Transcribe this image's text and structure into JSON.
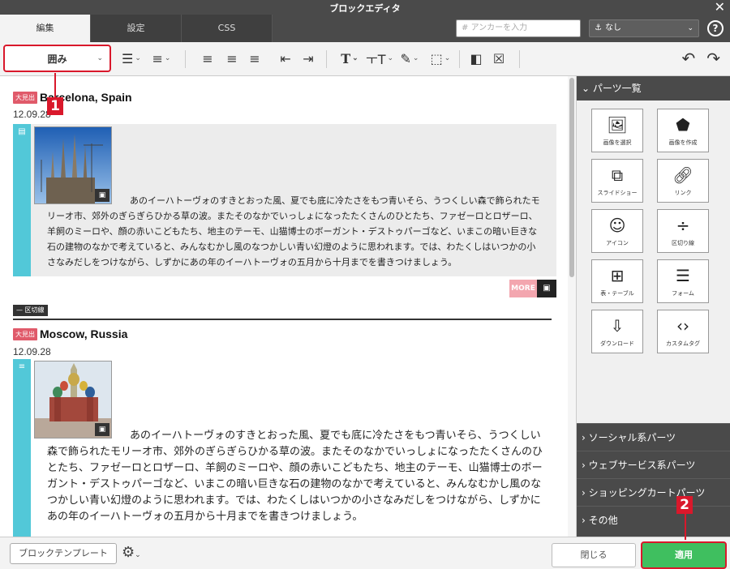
{
  "window": {
    "title": "ブロックエディタ",
    "close": "✕"
  },
  "tabs": [
    "編集",
    "設定",
    "CSS"
  ],
  "anchor": {
    "placeholder": "アンカーを入力",
    "icon": "#"
  },
  "anchor_select": {
    "value": "なし",
    "icon": "anchor-icon"
  },
  "help": "?",
  "toolbar": {
    "block_type": "囲み",
    "caret": "⌄",
    "undo": "↶",
    "redo": "↷"
  },
  "callouts": {
    "one": "1",
    "two": "2"
  },
  "articles": [
    {
      "badge": "大見出",
      "title": "Barcelona, Spain",
      "date": "12.09.28",
      "paragraph": "あのイーハトーヴォのすきとおった風、夏でも底に冷たさをもつ青いそら、うつくしい森で飾られたモリーオ市、郊外のぎらぎらひかる草の波。またそのなかでいっしょになったたくさんのひとたち、ファゼーロとロザーロ、羊飼のミーロや、顔の赤いこどもたち、地主のテーモ、山猫博士のボーガント・デストゥパーゴなど、いまこの暗い巨きな石の建物のなかで考えていると、みんなむかし風のなつかしい青い幻燈のように思われます。では、わたくしはいつかの小さなみだしをつけながら、しずかにあの年のイーハトーヴォの五月から十月までを書きつけましょう。"
    },
    {
      "badge": "大見出",
      "title": "Moscow, Russia",
      "date": "12.09.28",
      "paragraph": "あのイーハトーヴォのすきとおった風、夏でも底に冷たさをもつ青いそら、うつくしい森で飾られたモリーオ市、郊外のぎらぎらひかる草の波。またそのなかでいっしょになったたくさんのひとたち、ファゼーロとロザーロ、羊飼のミーロや、顔の赤いこどもたち、地主のテーモ、山猫博士のボーガント・デストゥパーゴなど、いまこの暗い巨きな石の建物のなかで考えていると、みんなむかし風のなつかしい青い幻燈のように思われます。では、わたくしはいつかの小さなみだしをつけながら、しずかにあの年のイーハトーヴォの五月から十月までを書きつけましょう。"
    }
  ],
  "more_tag": "MORE",
  "divider_label": "区切線",
  "panel": {
    "header": "パーツ一覧",
    "parts": [
      {
        "label": "画像を選択",
        "icon": "image-icon"
      },
      {
        "label": "画像を作成",
        "icon": "shapes-icon"
      },
      {
        "label": "スライドショー",
        "icon": "slideshow-icon"
      },
      {
        "label": "リンク",
        "icon": "link-icon"
      },
      {
        "label": "アイコン",
        "icon": "smiley-icon"
      },
      {
        "label": "区切り線",
        "icon": "divider-icon"
      },
      {
        "label": "表・テーブル",
        "icon": "table-icon"
      },
      {
        "label": "フォーム",
        "icon": "form-icon"
      },
      {
        "label": "ダウンロード",
        "icon": "download-icon"
      },
      {
        "label": "カスタムタグ",
        "icon": "code-icon"
      }
    ],
    "categories": [
      "ソーシャル系パーツ",
      "ウェブサービス系パーツ",
      "ショッピングカートパーツ",
      "その他"
    ]
  },
  "footer": {
    "template_button": "ブロックテンプレート",
    "close_button": "閉じる",
    "apply_button": "適用"
  },
  "colors": {
    "accent_red": "#d9182b",
    "cyan": "#52c8d8",
    "apply_green": "#3fbf5f",
    "dark": "#4a4a4a"
  }
}
